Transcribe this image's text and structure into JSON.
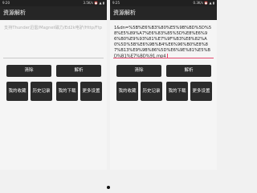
{
  "left": {
    "status": {
      "time": "9:20",
      "indicators": "3.5K/s ⏰ ▲ ▮"
    },
    "title": "资源解析",
    "input": {
      "placeholder": "支持Thunder迅雷/Magnet磁力/Ed2k电驴/Http/Ftp",
      "value": ""
    },
    "buttons": {
      "clear": "清除",
      "parse": "解析",
      "favorites": "我的收藏",
      "history": "历史记录",
      "downloads": "我的下载",
      "more": "更多设置"
    }
  },
  "right": {
    "status": {
      "time": "9:25",
      "indicators": "0.3K/s ⏰ ▲ ▮"
    },
    "title": "资源解析",
    "input": {
      "placeholder": "",
      "value": "1&dn=%5B%E6%B3%80%E5%9B%BD%5D%58%E5%89%A7%E6%83%85%5D%E8%E6%96%B0%E9%93%81%E7%9F%B3%E8%82%A0%5D%5B%E6%9B%B4%E6%96%B0%E8%87%B13%E9%9B%86%5D%E6%9E%81%E5%BD%B1%E7%BD%91.mp4"
    },
    "buttons": {
      "clear": "清除",
      "parse": "解析",
      "favorites": "我的收藏",
      "history": "历史记录",
      "downloads": "我的下载",
      "more": "更多设置"
    }
  },
  "colors": {
    "appbar": "#262626",
    "button": "#2b2b2b",
    "accent": "#e4476c"
  },
  "icons": {
    "page_indicator": "dot-icon"
  }
}
